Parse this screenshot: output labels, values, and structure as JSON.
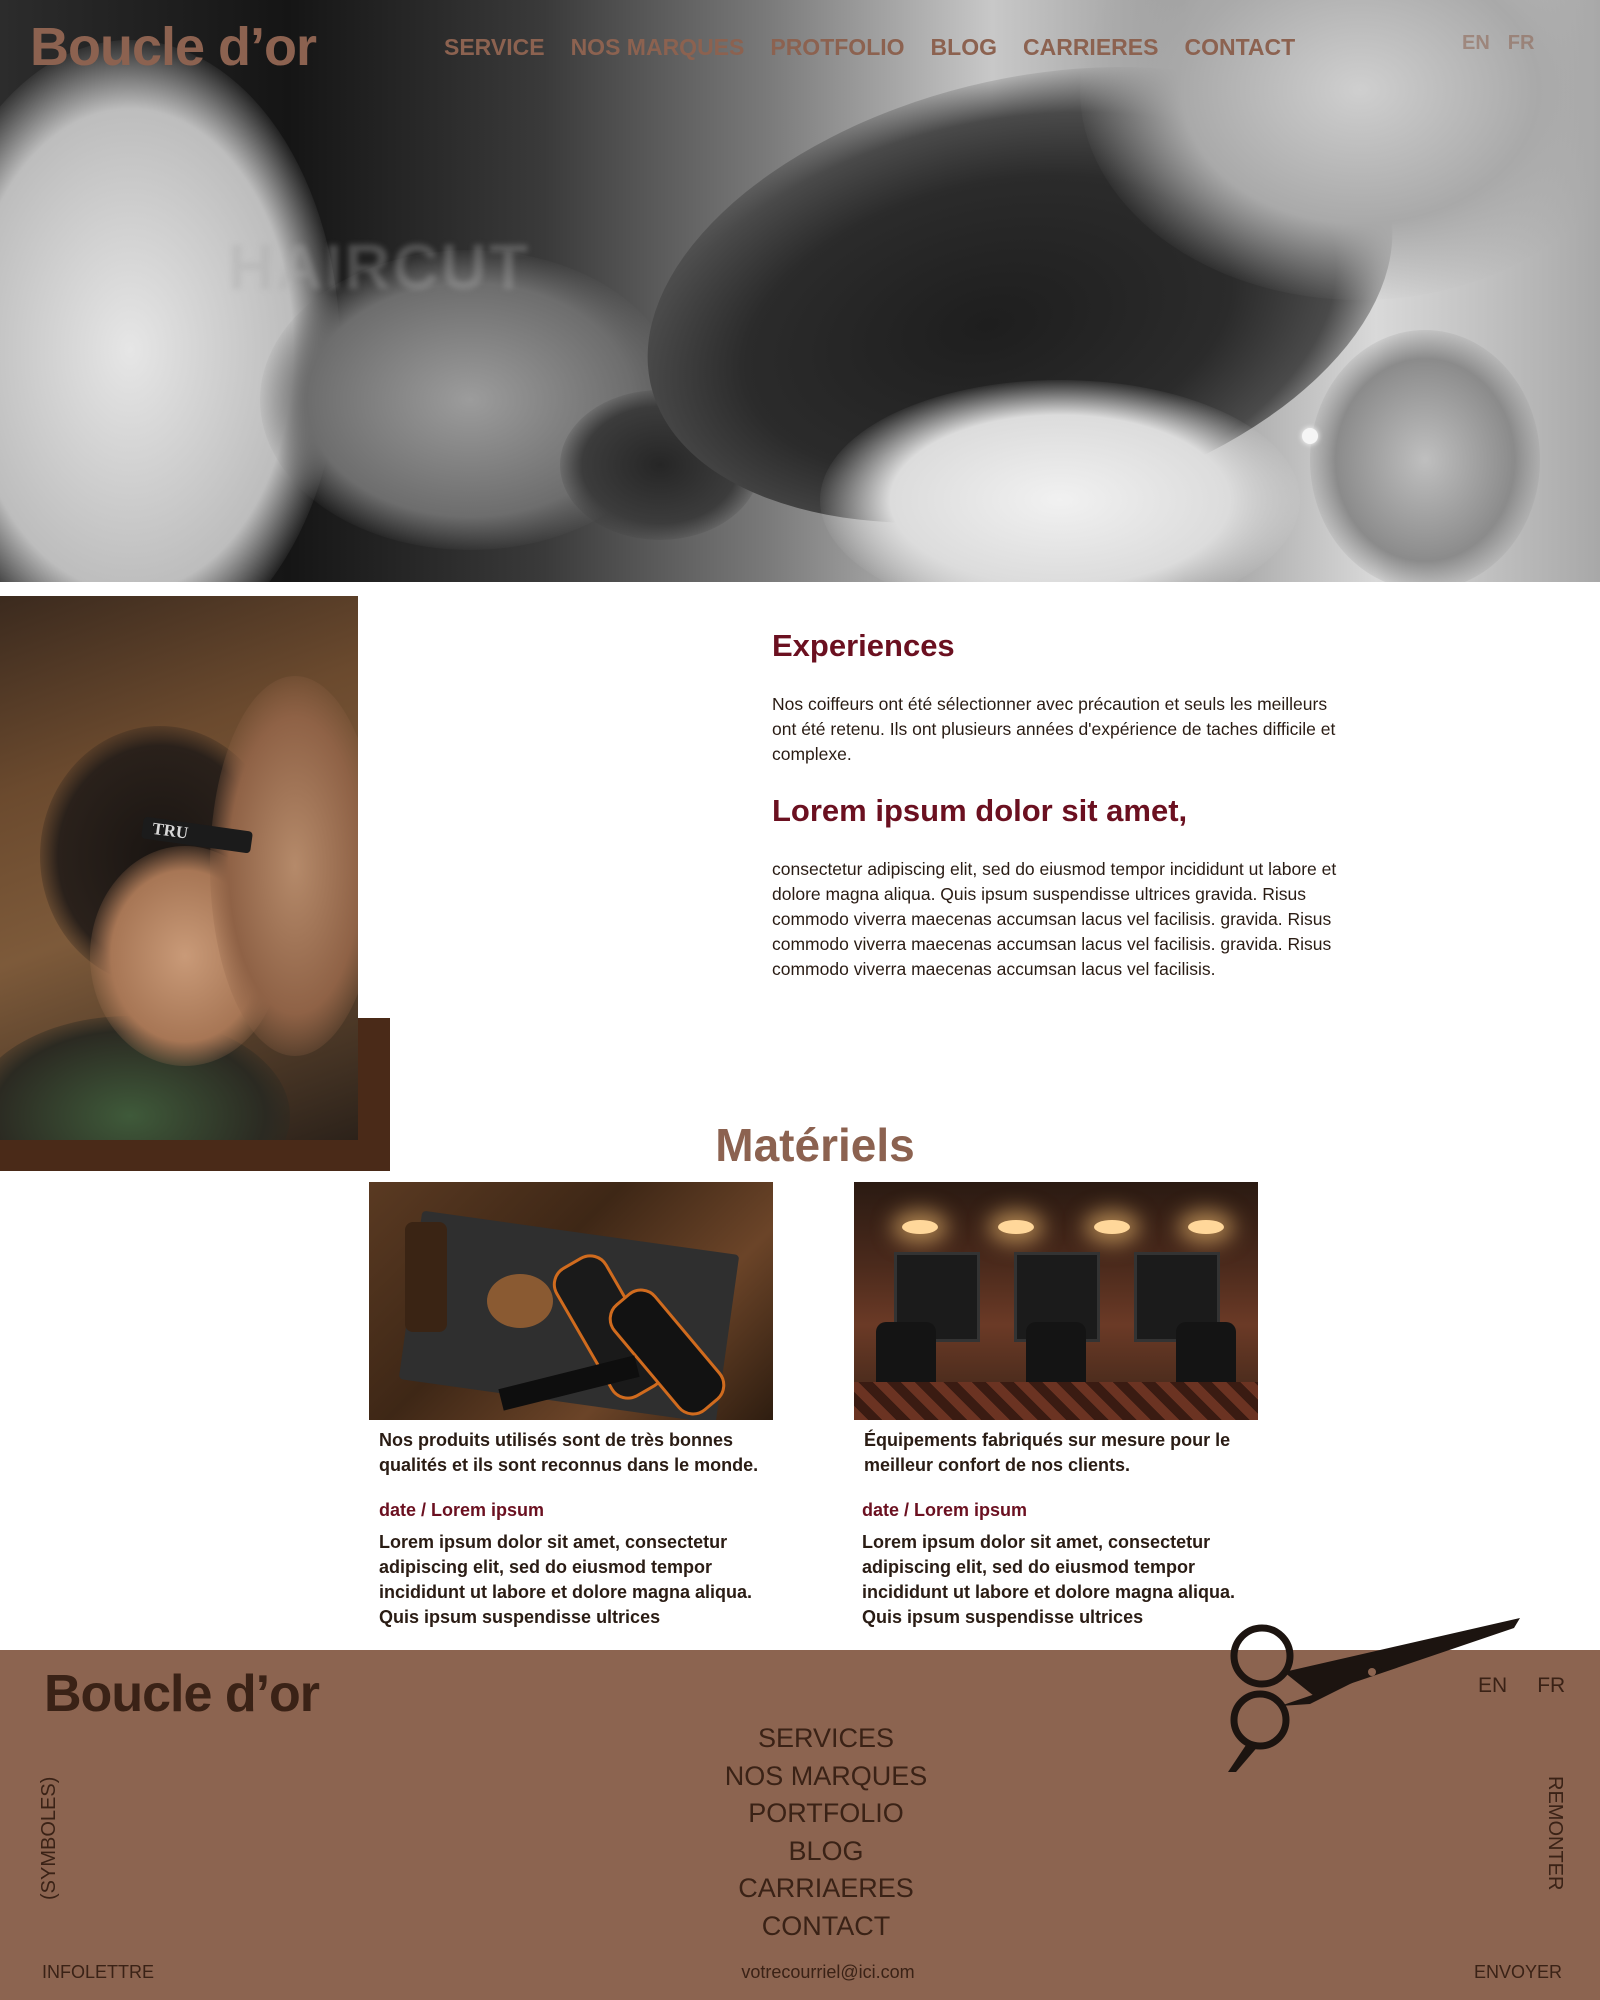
{
  "brand": {
    "name": "Boucle d’or"
  },
  "header": {
    "nav": [
      "SERVICE",
      "NOS MARQUES",
      "PROTFOLIO",
      "BLOG",
      "CARRIERES",
      "CONTACT"
    ],
    "lang": [
      "EN",
      "FR"
    ]
  },
  "hero": {
    "background_sign": "HAIRCUT"
  },
  "experiences": {
    "photo_label": "TRU",
    "title": "Experiences",
    "text": "Nos coiffeurs ont été sélectionner avec précaution et seuls les meilleurs ont été retenu. Ils ont plusieurs années d'expérience de taches difficile et complexe.",
    "subtitle": "Lorem ipsum dolor sit amet,",
    "body": "consectetur adipiscing elit, sed do eiusmod tempor incididunt ut labore et dolore magna aliqua. Quis ipsum suspendisse ultrices gravida. Risus commodo viverra maecenas accumsan lacus vel facilisis. gravida. Risus commodo viverra maecenas accumsan lacus vel facilisis. gravida. Risus commodo viverra maecenas accumsan lacus vel facilisis."
  },
  "materiels": {
    "title": "Matériels",
    "cards": [
      {
        "intro": "Nos produits utilisés sont de très bonnes qualités et ils sont reconnus dans le monde.",
        "date": "date / Lorem ipsum",
        "body": "Lorem ipsum dolor sit amet, consectetur adipiscing elit, sed do eiusmod tempor incididunt ut labore et dolore magna aliqua. Quis ipsum suspendisse ultrices"
      },
      {
        "intro": "Équipements fabriqués sur mesure pour le meilleur confort de nos clients.",
        "date": "date / Lorem ipsum",
        "body": "Lorem ipsum dolor sit amet, consectetur adipiscing elit, sed do eiusmod tempor incididunt ut labore et dolore magna aliqua. Quis ipsum suspendisse ultrices"
      }
    ]
  },
  "footer": {
    "logo": "Boucle d’or",
    "nav": [
      "SERVICES",
      "NOS MARQUES",
      "PORTFOLIO",
      "BLOG",
      "CARRIAERES",
      "CONTACT"
    ],
    "lang": [
      "EN",
      "FR"
    ],
    "symbols_label": "(SYMBOLES)",
    "back_to_top": "REMONTER",
    "newsletter_label": "INFOLETTRE",
    "email_placeholder": "votrecourriel@ici.com",
    "send_label": "ENVOYER"
  },
  "colors": {
    "brand": "#8c6250",
    "accent": "#6b1020",
    "footer_bg": "#8c6450",
    "footer_text": "#3a2216",
    "dark_block": "#4a2a18"
  },
  "icons": {
    "decoration": "scissors-icon"
  }
}
